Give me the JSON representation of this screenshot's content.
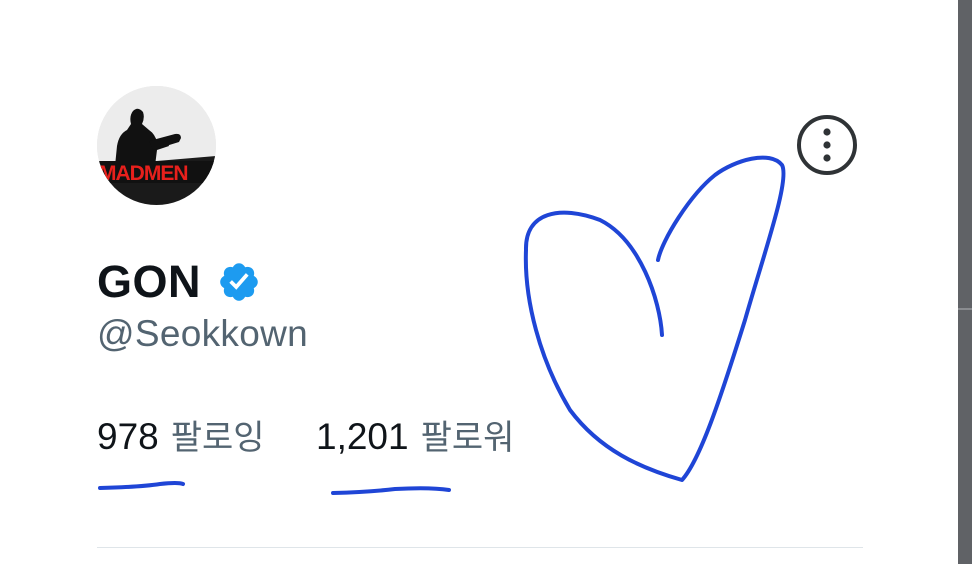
{
  "profile": {
    "display_name": "GON",
    "handle": "@Seokkown",
    "verified": true,
    "avatar_text": "MADMEN"
  },
  "stats": {
    "following_count": "978",
    "following_label": "팔로잉",
    "followers_count": "1,201",
    "followers_label": "팔로워"
  },
  "icons": {
    "more": "more-options-icon",
    "verified": "verified-badge-icon"
  },
  "colors": {
    "text_primary": "#0f1419",
    "text_secondary": "#536471",
    "verified_blue": "#1d9bf0",
    "annotation_blue": "#1f45d6"
  }
}
